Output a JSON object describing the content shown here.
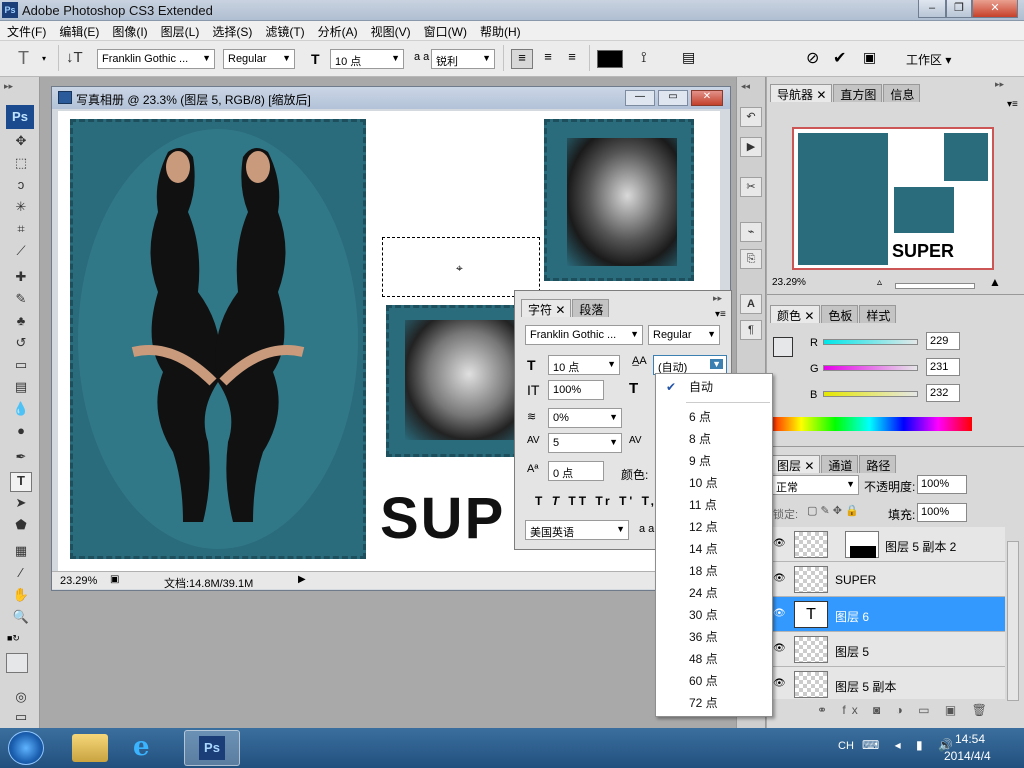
{
  "app": {
    "title": "Adobe Photoshop CS3 Extended",
    "logo": "Ps"
  },
  "menu": [
    "文件(F)",
    "编辑(E)",
    "图像(I)",
    "图层(L)",
    "选择(S)",
    "滤镜(T)",
    "分析(A)",
    "视图(V)",
    "窗口(W)",
    "帮助(H)"
  ],
  "options": {
    "font_family": "Franklin Gothic ...",
    "font_style": "Regular",
    "font_size": "10 点",
    "aa_label": "a a",
    "antialias": "锐利",
    "workspace": "工作区"
  },
  "document": {
    "title": "写真相册 @ 23.3% (图层 5, RGB/8) [缩放后]",
    "zoom": "23.29%",
    "file_info": "文档:14.8M/39.1M",
    "canvas_text": "SUP",
    "colors": {
      "photo_bg": "#2a6b7c",
      "frame": "#1e4f5c"
    }
  },
  "character_panel": {
    "tabs": [
      "字符",
      "段落"
    ],
    "font_family": "Franklin Gothic ...",
    "font_style": "Regular",
    "font_size": "10 点",
    "leading": "(自动)",
    "vscale": "100%",
    "tracking_a": "0%",
    "tracking_b": "5",
    "baseline": "0 点",
    "color_label": "颜色:",
    "language": "美国英语",
    "aa": "a a",
    "style_buttons": [
      "T",
      "T",
      "TT",
      "Tr",
      "T'",
      "T,"
    ]
  },
  "size_menu": {
    "selected": "自动",
    "items": [
      "6 点",
      "8 点",
      "9 点",
      "10 点",
      "11 点",
      "12 点",
      "14 点",
      "18 点",
      "24 点",
      "30 点",
      "36 点",
      "48 点",
      "60 点",
      "72 点"
    ]
  },
  "navigator": {
    "tabs": [
      "导航器",
      "直方图",
      "信息"
    ],
    "zoom": "23.29%",
    "preview_text": "SUPER"
  },
  "color_panel": {
    "tabs": [
      "颜色",
      "色板",
      "样式"
    ],
    "channels": [
      {
        "name": "R",
        "value": "229",
        "fraction": 0.898
      },
      {
        "name": "G",
        "value": "231",
        "fraction": 0.906
      },
      {
        "name": "B",
        "value": "232",
        "fraction": 0.91
      }
    ]
  },
  "layers_panel": {
    "tabs": [
      "图层",
      "通道",
      "路径"
    ],
    "blend_mode": "正常",
    "opacity_label": "不透明度:",
    "opacity": "100%",
    "lock_label": "锁定:",
    "fill_label": "填充:",
    "fill": "100%",
    "layers": [
      {
        "name": "图层 5 副本 2",
        "selected": false
      },
      {
        "name": "SUPER",
        "selected": false
      },
      {
        "name": "图层 6",
        "selected": true,
        "thumb": "T"
      },
      {
        "name": "图层 5",
        "selected": false
      },
      {
        "name": "图层 5 副本",
        "selected": false
      }
    ]
  },
  "taskbar": {
    "lang": "CH",
    "time": "14:54",
    "date": "2014/4/4",
    "ps_label": "Ps"
  }
}
